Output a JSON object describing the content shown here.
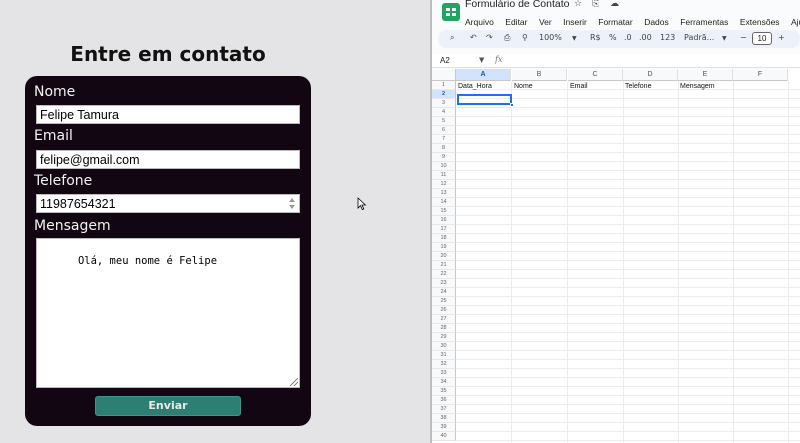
{
  "form": {
    "title": "Entre em contato",
    "name_label": "Nome",
    "name_value": "Felipe Tamura",
    "email_label": "Email",
    "email_value": "felipe@gmail.com",
    "phone_label": "Telefone",
    "phone_value": "11987654321",
    "message_label": "Mensagem",
    "message_value": "Olá, meu nome é Felipe",
    "submit_label": "Enviar"
  },
  "sheets": {
    "doc_title": "Formulário de Contato",
    "title_icons": [
      "star-icon",
      "move-folder-icon",
      "cloud-status-icon"
    ],
    "menu": [
      "Arquivo",
      "Editar",
      "Ver",
      "Inserir",
      "Formatar",
      "Dados",
      "Ferramentas",
      "Extensões",
      "Ajuda"
    ],
    "toolbar": {
      "zoom": "100%",
      "currency": "R$",
      "percent": "%",
      "decrease_decimals": ".0",
      "increase_decimals": ".00",
      "number_format": "123",
      "font": "Padrã...",
      "font_size": "10",
      "minus": "−",
      "plus": "+"
    },
    "name_box": "A2",
    "fx": "fx",
    "columns": [
      "A",
      "B",
      "C",
      "D",
      "E",
      "F"
    ],
    "headers": [
      "Data_Hora",
      "Nome",
      "Email",
      "Telefone",
      "Mensagem"
    ],
    "rows": [
      "1",
      "2",
      "3",
      "4",
      "5",
      "6",
      "7",
      "8",
      "9",
      "10",
      "11",
      "12",
      "13",
      "14",
      "15",
      "16",
      "17",
      "18",
      "19",
      "20",
      "21",
      "22",
      "23",
      "24",
      "25",
      "26",
      "27",
      "28",
      "29",
      "30",
      "31",
      "32",
      "33",
      "34",
      "35",
      "36",
      "37",
      "38",
      "39",
      "40"
    ],
    "selected_cell": "A2"
  }
}
